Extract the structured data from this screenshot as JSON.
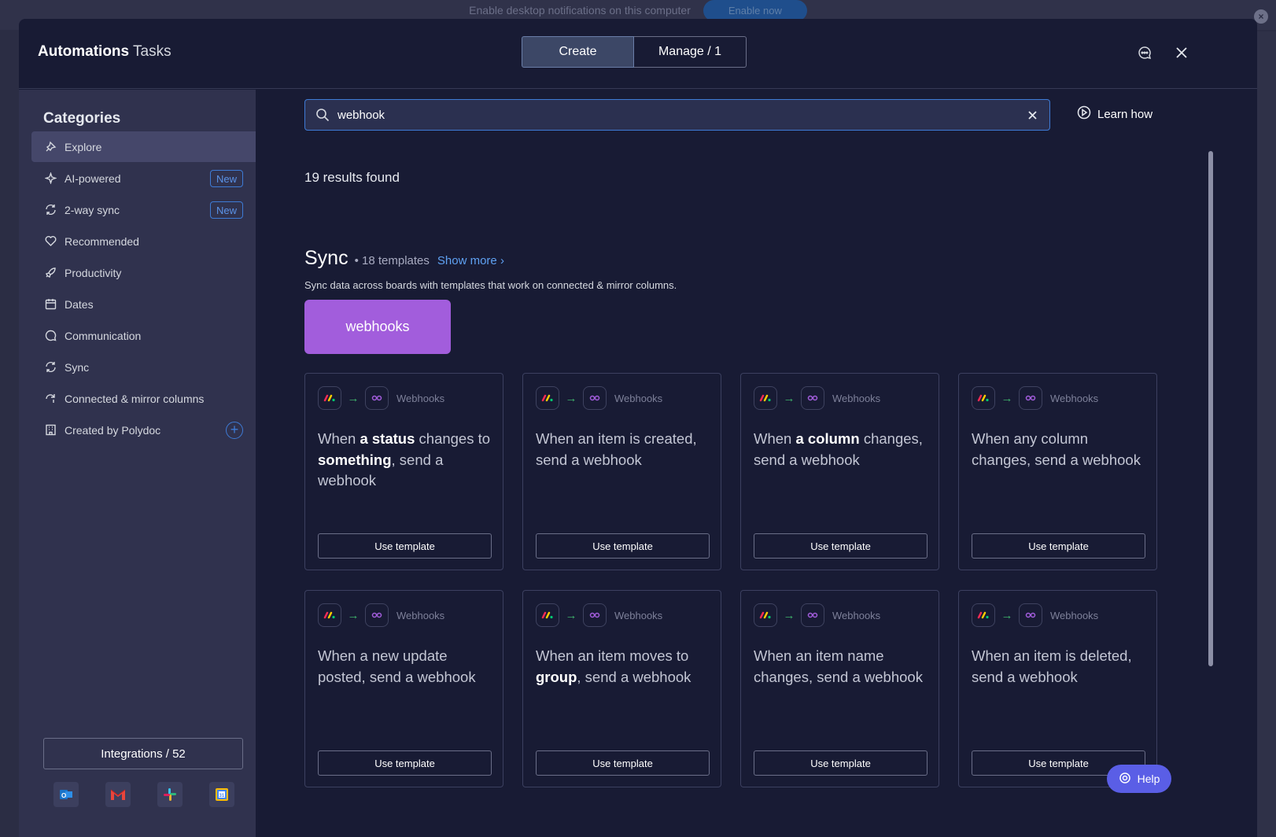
{
  "notification": {
    "text": "Enable desktop notifications on this computer",
    "button": "Enable now"
  },
  "header": {
    "title_bold": "Automations",
    "title_light": "Tasks",
    "tabs": [
      {
        "label": "Create",
        "active": true
      },
      {
        "label": "Manage / 1",
        "active": false
      }
    ]
  },
  "sidebar": {
    "title": "Categories",
    "items": [
      {
        "label": "Explore",
        "icon": "explore-icon",
        "selected": true
      },
      {
        "label": "AI-powered",
        "icon": "sparkle-icon",
        "badge": "New"
      },
      {
        "label": "2-way sync",
        "icon": "sync-icon",
        "badge": "New"
      },
      {
        "label": "Recommended",
        "icon": "heart-icon"
      },
      {
        "label": "Productivity",
        "icon": "rocket-icon"
      },
      {
        "label": "Dates",
        "icon": "calendar-icon"
      },
      {
        "label": "Communication",
        "icon": "chat-icon"
      },
      {
        "label": "Sync",
        "icon": "sync-icon"
      },
      {
        "label": "Connected & mirror columns",
        "icon": "connect-icon"
      },
      {
        "label": "Created by Polydoc",
        "icon": "building-icon"
      }
    ],
    "integrations_label": "Integrations / 52",
    "integration_apps": [
      "outlook",
      "gmail",
      "slack",
      "google-calendar"
    ]
  },
  "search": {
    "value": "webhook",
    "learn_how": "Learn how"
  },
  "results_text": "19 results found",
  "section": {
    "title": "Sync",
    "count": "18 templates",
    "show_more": "Show more",
    "description": "Sync data across boards with templates that work on connected & mirror columns.",
    "banner": "webhooks"
  },
  "cards": [
    {
      "app": "Webhooks",
      "parts": [
        [
          "When ",
          false
        ],
        [
          "a status",
          true
        ],
        [
          " changes to ",
          false
        ],
        [
          "something",
          true
        ],
        [
          ", send a webhook",
          false
        ]
      ],
      "button": "Use template"
    },
    {
      "app": "Webhooks",
      "parts": [
        [
          "When an item is created, send a webhook",
          false
        ]
      ],
      "button": "Use template"
    },
    {
      "app": "Webhooks",
      "parts": [
        [
          "When ",
          false
        ],
        [
          "a column",
          true
        ],
        [
          " changes, send a webhook",
          false
        ]
      ],
      "button": "Use template"
    },
    {
      "app": "Webhooks",
      "parts": [
        [
          "When any column changes, send a webhook",
          false
        ]
      ],
      "button": "Use template"
    },
    {
      "app": "Webhooks",
      "parts": [
        [
          "When a new update posted, send a webhook",
          false
        ]
      ],
      "button": "Use template"
    },
    {
      "app": "Webhooks",
      "parts": [
        [
          "When an item moves to ",
          false
        ],
        [
          "group",
          true
        ],
        [
          ", send a webhook",
          false
        ]
      ],
      "button": "Use template"
    },
    {
      "app": "Webhooks",
      "parts": [
        [
          "When an item name changes, send a webhook",
          false
        ]
      ],
      "button": "Use template"
    },
    {
      "app": "Webhooks",
      "parts": [
        [
          "When an item is deleted, send a webhook",
          false
        ]
      ],
      "button": "Use template"
    }
  ],
  "help_label": "Help",
  "colors": {
    "accent": "#3e7bd6",
    "banner": "#a25ddc",
    "help": "#5a5ee6"
  }
}
